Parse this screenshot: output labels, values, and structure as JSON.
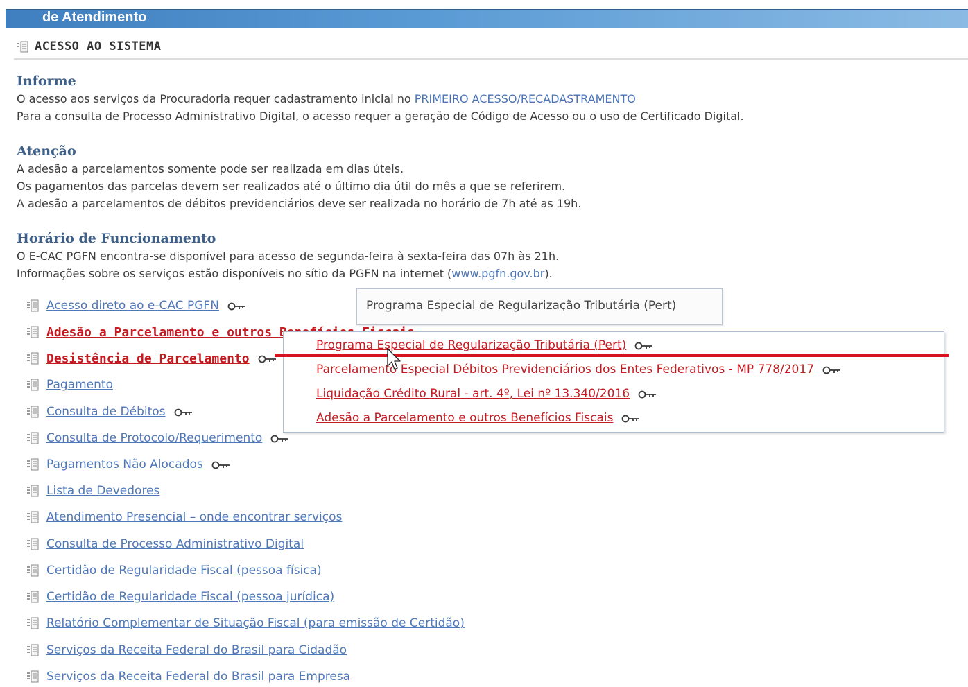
{
  "header": {
    "title": "de Atendimento",
    "section": "ACESSO AO SISTEMA",
    "section_icon": "document-list-icon"
  },
  "informe": {
    "title": "Informe",
    "line1_text": "O acesso aos serviços da Procuradoria requer cadastramento inicial no ",
    "line1_link": "PRIMEIRO ACESSO/RECADASTRAMENTO",
    "line2": "Para a consulta de Processo Administrativo Digital, o acesso requer a geração de Código de Acesso ou o uso de Certificado Digital."
  },
  "atencao": {
    "title": "Atenção",
    "line1": "A adesão a parcelamentos somente pode ser realizada em dias úteis.",
    "line2": "Os pagamentos das parcelas devem ser realizados até o último dia útil do mês a que se referirem.",
    "line3": "A adesão a parcelamentos de débitos previdenciários deve ser realizada no horário de 7h até as 19h."
  },
  "horario": {
    "title": "Horário de Funcionamento",
    "line1": "O E-CAC PGFN encontra-se disponível para acesso de segunda-feira à sexta-feira das 07h às 21h.",
    "line2_text": "Informações sobre os serviços estão disponíveis no sítio da PGFN na internet (",
    "line2_link": "www.pgfn.gov.br",
    "line2_end": ")."
  },
  "nav": {
    "items": [
      {
        "label": "Acesso direto ao e-CAC PGFN",
        "key": true,
        "red": false
      },
      {
        "label": "Adesão a Parcelamento e outros Benefícios Fiscais",
        "key": false,
        "red": true
      },
      {
        "label": "Desistência de Parcelamento",
        "key": true,
        "red": true
      },
      {
        "label": "Pagamento",
        "key": false,
        "red": false
      },
      {
        "label": "Consulta de Débitos",
        "key": true,
        "red": false
      },
      {
        "label": "Consulta de Protocolo/Requerimento",
        "key": true,
        "red": false
      },
      {
        "label": "Pagamentos Não Alocados",
        "key": true,
        "red": false
      },
      {
        "label": "Lista de Devedores",
        "key": false,
        "red": false
      },
      {
        "label": "Atendimento Presencial – onde encontrar serviços",
        "key": false,
        "red": false
      },
      {
        "label": "Consulta de Processo Administrativo Digital",
        "key": false,
        "red": false
      },
      {
        "label": "Certidão de Regularidade Fiscal (pessoa física)",
        "key": false,
        "red": false
      },
      {
        "label": "Certidão de Regularidade Fiscal (pessoa jurídica)",
        "key": false,
        "red": false
      },
      {
        "label": "Relatório Complementar de Situação Fiscal (para emissão de Certidão)",
        "key": false,
        "red": false
      },
      {
        "label": "Serviços da Receita Federal do Brasil para Cidadão",
        "key": false,
        "red": false
      },
      {
        "label": "Serviços da Receita Federal do Brasil para Empresa",
        "key": false,
        "red": false
      }
    ]
  },
  "tooltip": {
    "text": "Programa Especial de Regularização Tributária (Pert)"
  },
  "submenu": {
    "items": [
      {
        "label": "Programa Especial de Regularização Tributária (Pert)",
        "hover": true
      },
      {
        "label": "Parcelamento Especial Débitos Previdenciários dos Entes Federativos - MP 778/2017",
        "hover": false
      },
      {
        "label": "Liquidação Crédito Rural - art. 4º, Lei nº 13.340/2016",
        "hover": false
      },
      {
        "label": "Adesão a Parcelamento e outros Benefícios Fiscais",
        "hover": false
      }
    ]
  },
  "colors": {
    "link_blue": "#4f78b8",
    "link_red": "#c21c22",
    "heading_blue": "#3d5f88",
    "top_bar": "#5b9bd5",
    "annotation_red": "#d9121f"
  }
}
